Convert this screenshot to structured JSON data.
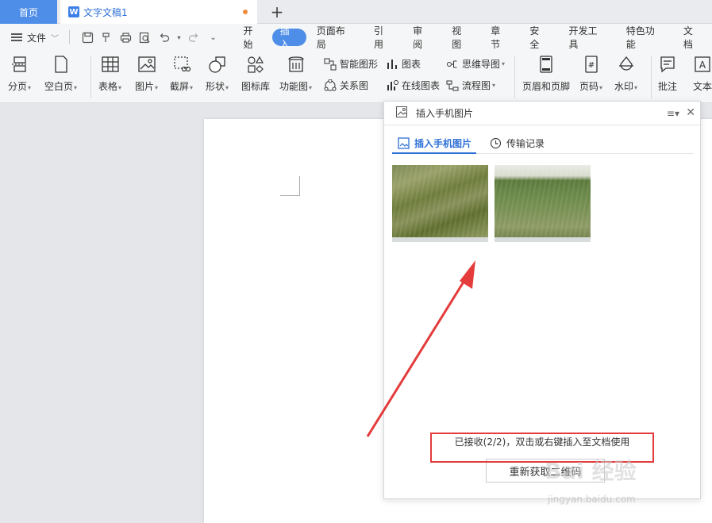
{
  "titlebar": {
    "home_tab": "首页",
    "doc_tab": "文字文稿1",
    "doc_icon": "W",
    "new_tab_symbol": "+"
  },
  "menubar": {
    "file_label": "文件",
    "tabs": [
      "开始",
      "插入",
      "页面布局",
      "引用",
      "审阅",
      "视图",
      "章节",
      "安全",
      "开发工具",
      "特色功能",
      "文档"
    ],
    "active_tab": "插入"
  },
  "ribbon": {
    "page_break": "分页",
    "blank_page": "空白页",
    "table": "表格",
    "picture": "图片",
    "screenshot": "截屏",
    "shape": "形状",
    "icon_lib": "图标库",
    "func_chart": "功能图",
    "smart_shape": "智能图形",
    "relation_chart": "关系图",
    "chart": "图表",
    "online_chart": "在线图表",
    "mind_map": "思维导图",
    "flow_chart": "流程图",
    "header_footer": "页眉和页脚",
    "page_number": "页码",
    "watermark": "水印",
    "comment": "批注",
    "text": "文本"
  },
  "panel": {
    "title": "插入手机图片",
    "tabs": [
      "插入手机图片",
      "传输记录"
    ],
    "status": "已接收(2/2)，双击或右键插入至文档使用",
    "refresh_button": "重新获取二维码"
  },
  "watermark": {
    "brand": "Bai 经验",
    "url": "jingyan.baidu.com"
  },
  "colors": {
    "accent": "#4f8ee8",
    "highlight_red": "#e43b3b"
  }
}
